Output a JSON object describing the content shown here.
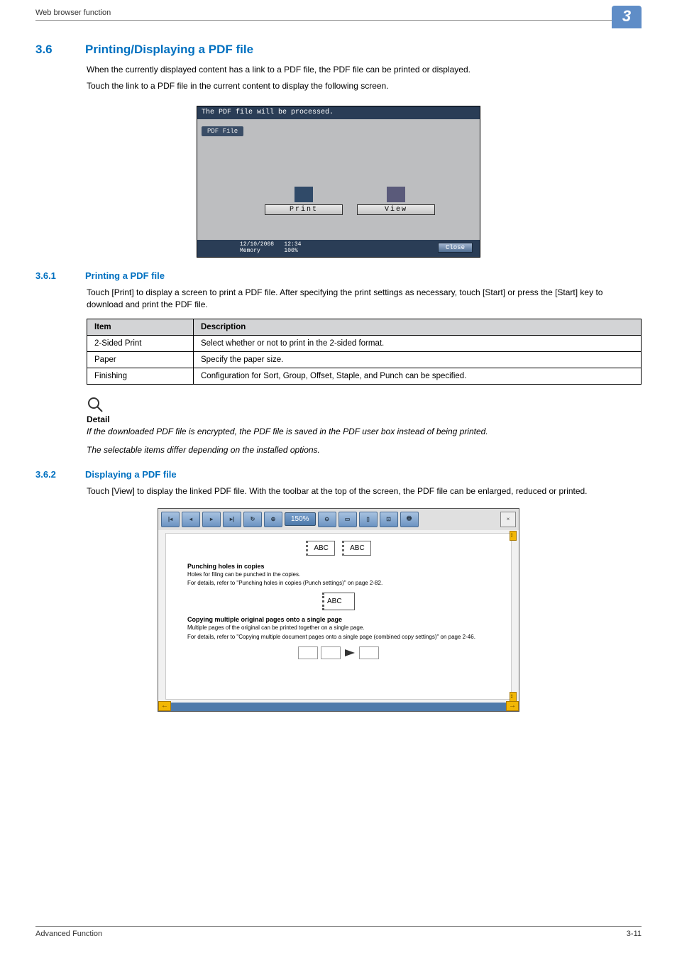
{
  "header": {
    "left": "Web browser function",
    "tab": "3"
  },
  "section36": {
    "num": "3.6",
    "title": "Printing/Displaying a PDF file",
    "para1": "When the currently displayed content has a link to a PDF file, the PDF file can be printed or displayed.",
    "para2": "Touch the link to a PDF file in the current content to display the following screen."
  },
  "shot1": {
    "top": "The PDF file will be processed.",
    "tab": "PDF File",
    "print": "Print",
    "view": "View",
    "datetime": "12/10/2008   12:34\nMemory       100%",
    "close": "Close"
  },
  "section361": {
    "num": "3.6.1",
    "title": "Printing a PDF file",
    "para": "Touch [Print] to display a screen to print a PDF file. After specifying the print settings as necessary, touch [Start] or press the [Start] key to download and print the PDF file."
  },
  "table": {
    "head": {
      "c1": "Item",
      "c2": "Description"
    },
    "rows": [
      {
        "c1": "2-Sided Print",
        "c2": "Select whether or not to print in the 2-sided format."
      },
      {
        "c1": "Paper",
        "c2": "Specify the paper size."
      },
      {
        "c1": "Finishing",
        "c2": "Configuration for Sort, Group, Offset, Staple, and Punch can be specified."
      }
    ]
  },
  "detail": {
    "label": "Detail",
    "line1": "If the downloaded PDF file is encrypted, the PDF file is saved in the PDF user box instead of being printed.",
    "line2": "The selectable items differ depending on the installed options."
  },
  "section362": {
    "num": "3.6.2",
    "title": "Displaying a PDF file",
    "para": "Touch [View] to display the linked PDF file. With the toolbar at the top of the screen, the PDF file can be enlarged, reduced or printed."
  },
  "shot2": {
    "zoom": "150%",
    "abc": "ABC",
    "sect1": "Punching holes in copies",
    "l1": "Holes for filing can be punched in the copies.",
    "l2": "For details, refer to \"Punching holes in copies (Punch settings)\" on page 2-82.",
    "sect2": "Copying multiple original pages onto a single page",
    "l3": "Multiple pages of the original can be printed together on a single page.",
    "l4": "For details, refer to \"Copying multiple document pages onto a single page (combined copy settings)\" on page 2-46.",
    "x": "×",
    "al": "←",
    "ar": "→",
    "sb": "↕"
  },
  "footer": {
    "left": "Advanced Function",
    "right": "3-11"
  },
  "icons": {
    "first": "|◂",
    "prev": "◂",
    "next": "▸",
    "last": "▸|",
    "rot": "↻",
    "zin": "⊕",
    "zout": "⊖",
    "fitw": "▭",
    "fitp": "▯",
    "sel": "⊡",
    "prn": "🖶"
  }
}
